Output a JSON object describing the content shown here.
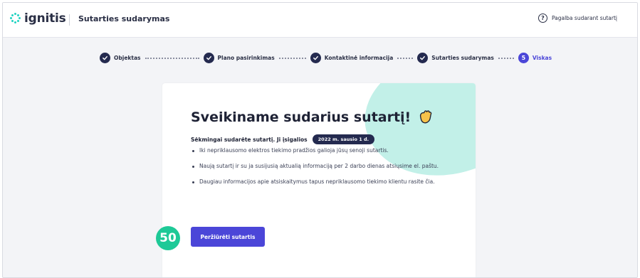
{
  "header": {
    "logo_text": "ignitis",
    "title": "Sutarties sudarymas",
    "help_label": "Pagalba sudarant sutartį",
    "help_icon": "?"
  },
  "stepper": {
    "steps": [
      {
        "label": "Objektas",
        "state": "done"
      },
      {
        "label": "Plano pasirinkimas",
        "state": "done"
      },
      {
        "label": "Kontaktinė informacija",
        "state": "done"
      },
      {
        "label": "Sutarties sudarymas",
        "state": "done"
      },
      {
        "label": "Viskas",
        "state": "active",
        "number": "5"
      }
    ]
  },
  "card": {
    "title": "Sveikiname sudarius sutartį!",
    "subline": "Sėkmingai sudarėte sutartį. Ji įsigalios",
    "date_badge": "2022 m. sausio 1 d.",
    "bullets": [
      "Iki nepriklausomo elektros tiekimo pradžios galioja jūsų senoji sutartis.",
      "Naują sutartį ir su ja susijusią aktualią informaciją per 2 darbo dienas atsiųsime el. paštu.",
      "Daugiau informacijos apie atsiskaitymus tapus nepriklausomo tiekimo klientu rasite čia."
    ],
    "button_label": "Peržiūrėti sutartis"
  },
  "annotation": {
    "badge_number": "50"
  },
  "colors": {
    "accent": "#4b46d8",
    "navy": "#242a4f",
    "teal": "#c2f0e8",
    "badge": "#1ec997"
  }
}
